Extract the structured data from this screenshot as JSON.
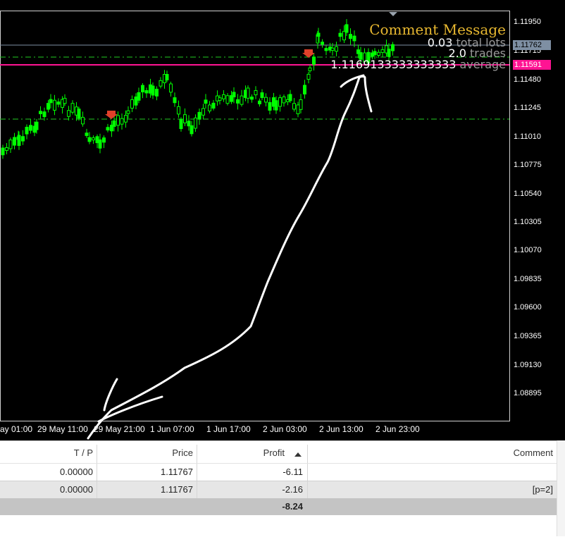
{
  "overlay": {
    "comment_title": "Comment Message",
    "lots_value": "0.03",
    "lots_label": "total lots",
    "trades_value": "2.0",
    "trades_label": "trades",
    "avg_value": "1.1169133333333333",
    "avg_label": "average"
  },
  "price_axis": {
    "labels": [
      "1.11950",
      "1.11715",
      "1.11480",
      "1.11245",
      "1.11010",
      "1.10775",
      "1.10540",
      "1.10305",
      "1.10070",
      "1.09835",
      "1.09600",
      "1.09365",
      "1.09130",
      "1.08895"
    ],
    "current_price_tag": "1.11762",
    "average_price_tag": "1.11591"
  },
  "time_axis": {
    "labels": [
      "ay 01:00",
      "29 May 11:00",
      "29 May 21:00",
      "1 Jun 07:00",
      "1 Jun 17:00",
      "2 Jun 03:00",
      "2 Jun 13:00",
      "2 Jun 23:00"
    ]
  },
  "colors": {
    "chart_bg": "#000000",
    "candle": "#00ff00",
    "average_line": "#ff1493",
    "current_line": "#7e8fa3",
    "comment": "#e8b830",
    "arrow": "#e0402a"
  },
  "table": {
    "headers": {
      "tp": "T / P",
      "price": "Price",
      "profit": "Profit",
      "comment": "Comment"
    },
    "rows": [
      {
        "tp": "0.00000",
        "price": "1.11767",
        "profit": "-6.11",
        "comment": ""
      },
      {
        "tp": "0.00000",
        "price": "1.11767",
        "profit": "-2.16",
        "comment": "[p=2]"
      }
    ],
    "total_profit": "-8.24"
  }
}
